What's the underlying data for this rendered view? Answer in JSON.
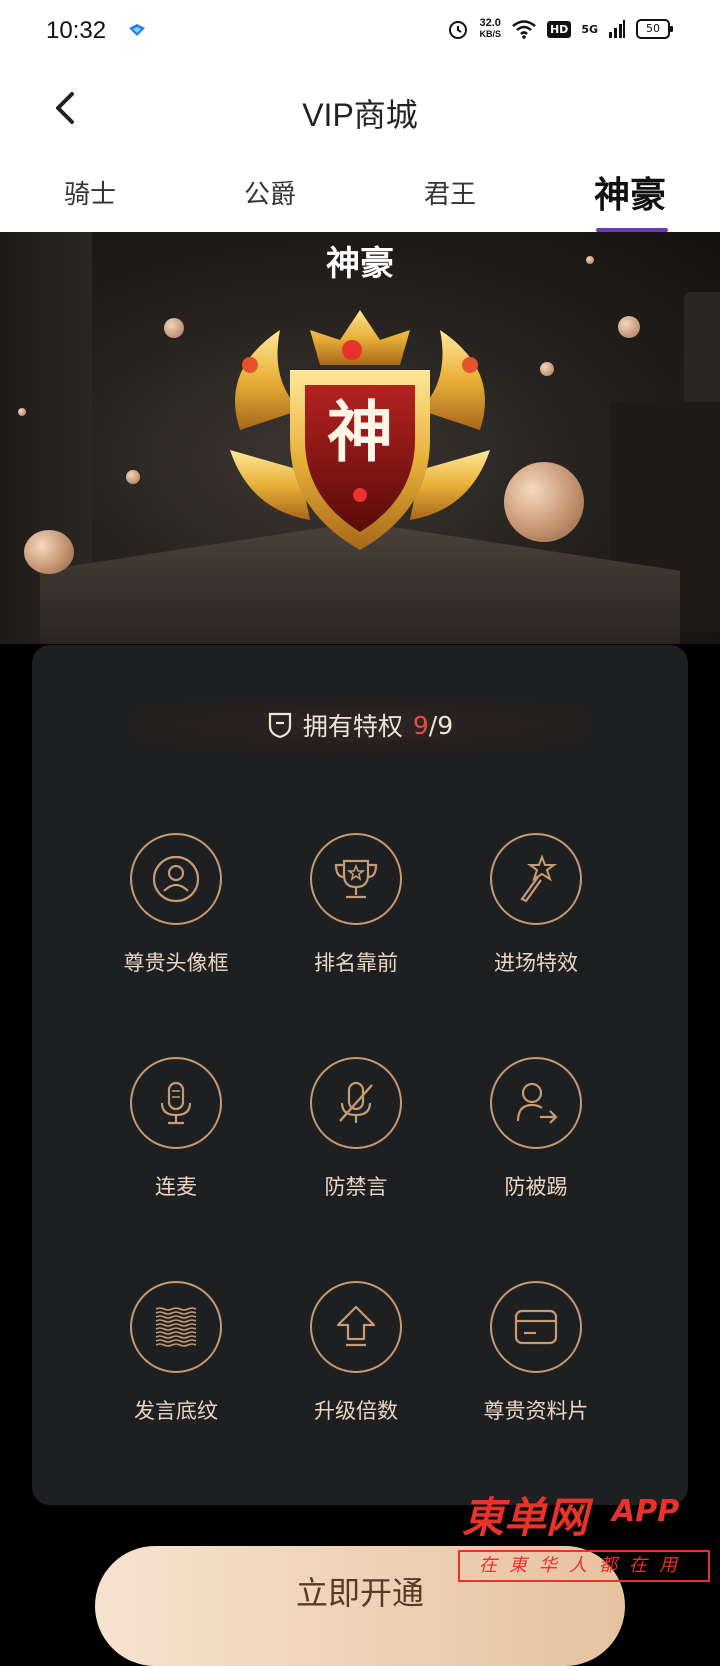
{
  "status_bar": {
    "time": "10:32",
    "net_speed": "32.0",
    "net_unit": "KB/S",
    "hd": "HD",
    "signal": "5G",
    "battery": "50"
  },
  "header": {
    "title": "VIP商城",
    "back_icon": "chevron-left-icon"
  },
  "tabs": [
    {
      "label": "骑士",
      "active": false
    },
    {
      "label": "公爵",
      "active": false
    },
    {
      "label": "君王",
      "active": false
    },
    {
      "label": "神豪",
      "active": true
    }
  ],
  "hero": {
    "title": "神豪",
    "badge_char": "神"
  },
  "privileges": {
    "label": "拥有特权",
    "owned": "9",
    "total": "/9",
    "items": [
      {
        "label": "尊贵头像框",
        "icon": "avatar-frame-icon"
      },
      {
        "label": "排名靠前",
        "icon": "trophy-icon"
      },
      {
        "label": "进场特效",
        "icon": "magic-wand-icon"
      },
      {
        "label": "连麦",
        "icon": "microphone-icon"
      },
      {
        "label": "防禁言",
        "icon": "mic-off-icon"
      },
      {
        "label": "防被踢",
        "icon": "user-exit-icon"
      },
      {
        "label": "发言底纹",
        "icon": "wave-pattern-icon"
      },
      {
        "label": "升级倍数",
        "icon": "upgrade-arrow-icon"
      },
      {
        "label": "尊贵资料片",
        "icon": "card-icon"
      }
    ]
  },
  "cta": {
    "label": "立即开通"
  },
  "watermark": {
    "brand": "東单网",
    "app": "APP",
    "tagline": "在東华人都在用"
  },
  "colors": {
    "accent": "#6a3db4",
    "gold": "#c69a72",
    "highlight": "#e84a3b"
  }
}
